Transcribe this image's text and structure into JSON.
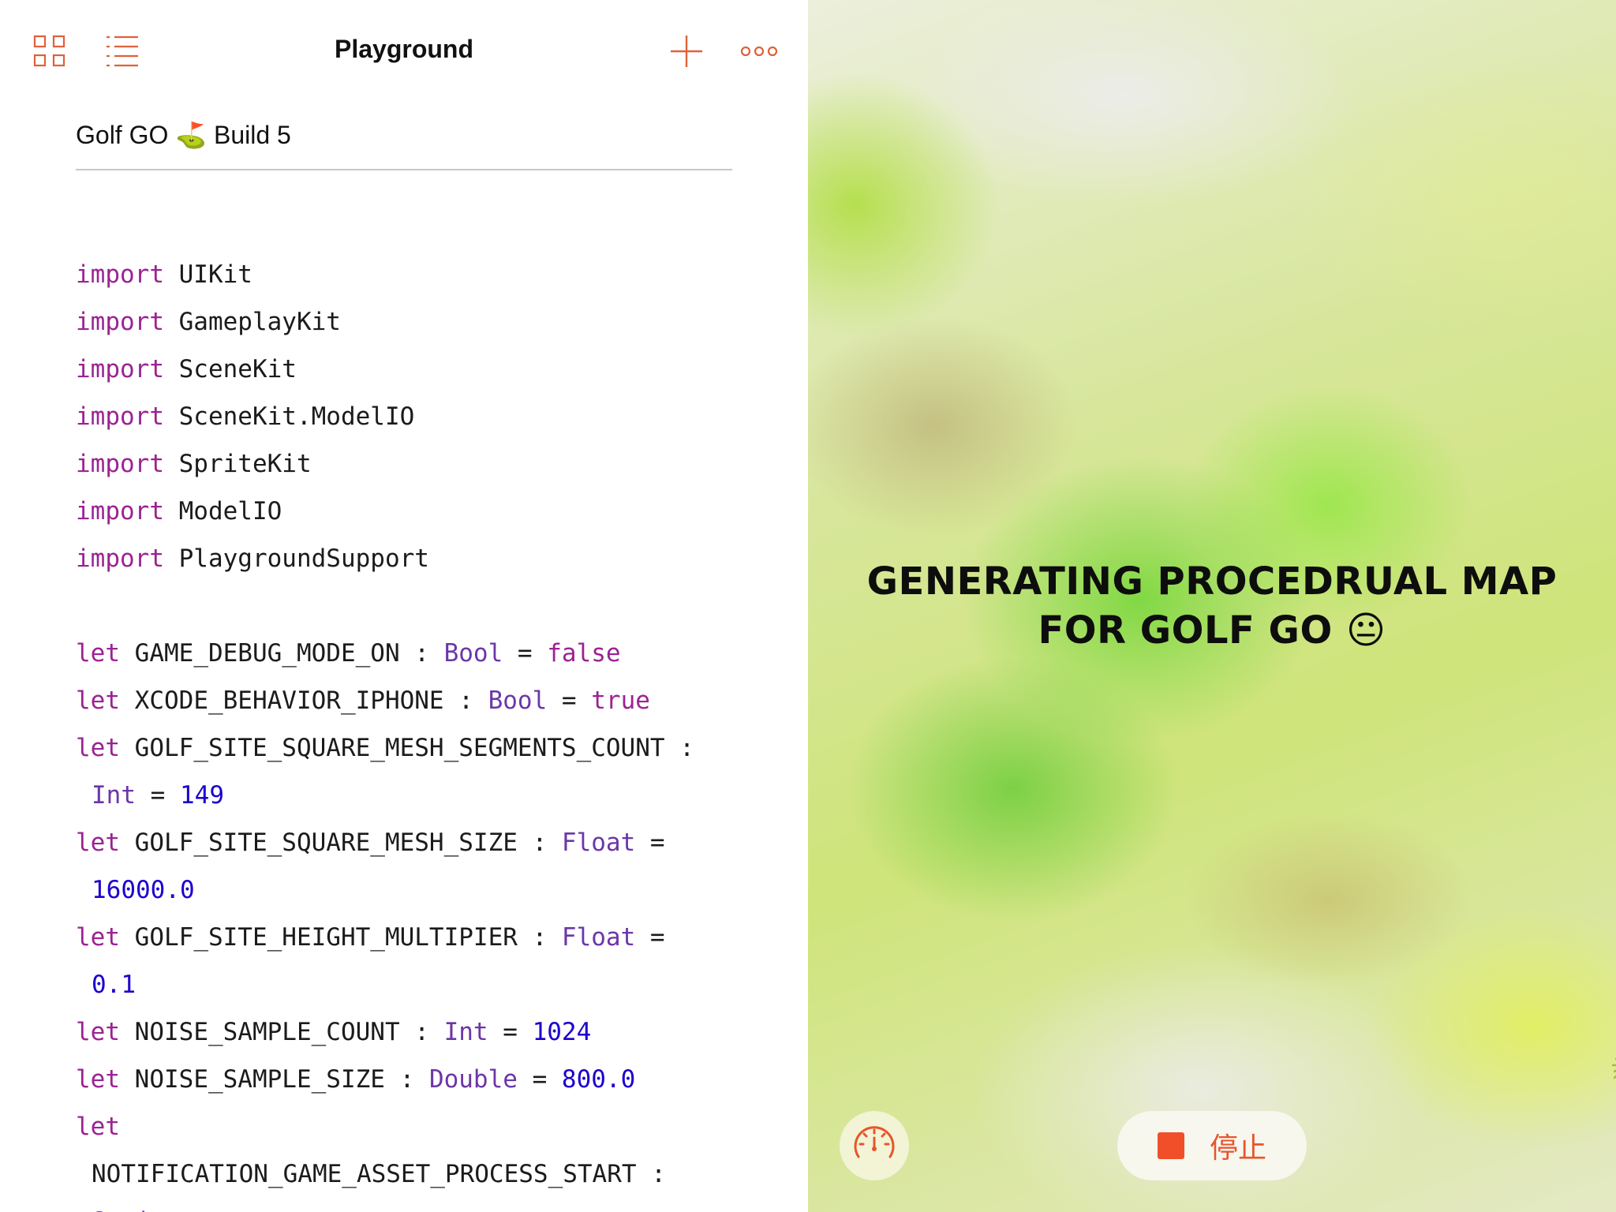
{
  "toolbar": {
    "title": "Playground",
    "accent_color": "#e0603a",
    "left_icons": [
      "grid-icon",
      "list-icon"
    ],
    "right_icons": [
      "plus-icon",
      "more-icon"
    ]
  },
  "document": {
    "title": "Golf GO ⛳️ Build 5"
  },
  "code": {
    "colors": {
      "keyword": "#9b2393",
      "type": "#6c36a9",
      "number": "#1c00cf",
      "text": "#1b1b1b"
    },
    "lines": [
      {
        "kw": "import",
        "rest": " UIKit"
      },
      {
        "kw": "import",
        "rest": " GameplayKit"
      },
      {
        "kw": "import",
        "rest": " SceneKit"
      },
      {
        "kw": "import",
        "rest": " SceneKit.ModelIO"
      },
      {
        "kw": "import",
        "rest": " SpriteKit"
      },
      {
        "kw": "import",
        "rest": " ModelIO"
      },
      {
        "kw": "import",
        "rest": " PlaygroundSupport"
      },
      {
        "blank": true
      },
      {
        "kw": "let",
        "rest": " GAME_DEBUG_MODE_ON : ",
        "ty": "Bool",
        "eq": " = ",
        "val": "false",
        "valKind": "kw"
      },
      {
        "kw": "let",
        "rest": " XCODE_BEHAVIOR_IPHONE : ",
        "ty": "Bool",
        "eq": " = ",
        "val": "true",
        "valKind": "kw"
      },
      {
        "kw": "let",
        "rest": " GOLF_SITE_SQUARE_MESH_SEGMENTS_COUNT :"
      },
      {
        "cont": true,
        "ty": "Int",
        "eq": " = ",
        "val": "149",
        "valKind": "num"
      },
      {
        "kw": "let",
        "rest": " GOLF_SITE_SQUARE_MESH_SIZE : ",
        "ty": "Float",
        "eq": " ="
      },
      {
        "cont": true,
        "val": "16000.0",
        "valKind": "num"
      },
      {
        "kw": "let",
        "rest": " GOLF_SITE_HEIGHT_MULTIPIER : ",
        "ty": "Float",
        "eq": " ="
      },
      {
        "cont": true,
        "val": "0.1",
        "valKind": "num"
      },
      {
        "kw": "let",
        "rest": " NOISE_SAMPLE_COUNT : ",
        "ty": "Int",
        "eq": " = ",
        "val": "1024",
        "valKind": "num"
      },
      {
        "kw": "let",
        "rest": " NOISE_SAMPLE_SIZE : ",
        "ty": "Double",
        "eq": " = ",
        "val": "800.0",
        "valKind": "num"
      },
      {
        "kw": "let"
      },
      {
        "cont": true,
        "rest": "NOTIFICATION_GAME_ASSET_PROCESS_START :"
      },
      {
        "cont": true,
        "ty": "String"
      }
    ]
  },
  "live_view": {
    "message": "GENERATING PROCEDRUAL MAP FOR GOLF GO 😐",
    "stop_label": "停止",
    "stop_color": "#f04f2a",
    "gauge_icon": "speedometer-icon"
  }
}
